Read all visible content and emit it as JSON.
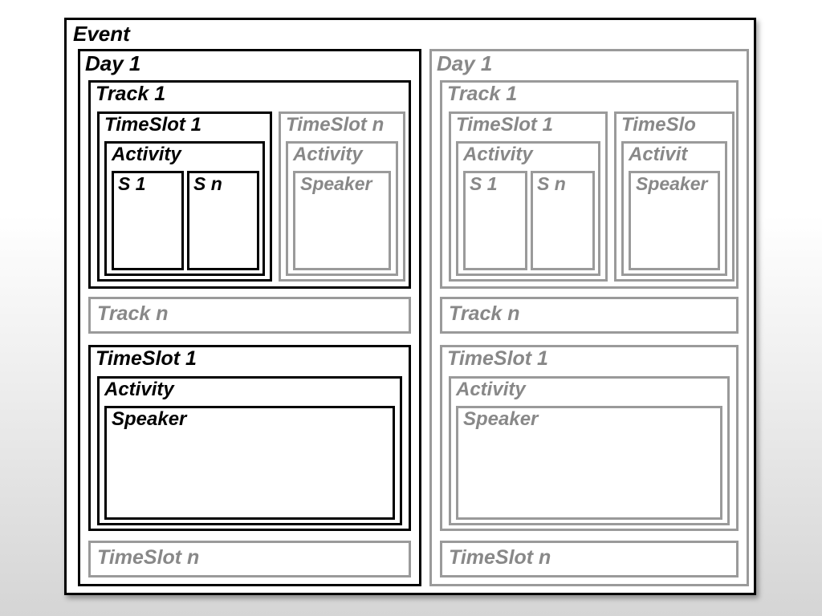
{
  "event": {
    "title": "Event"
  },
  "left": {
    "day": "Day 1",
    "track1": {
      "title": "Track 1",
      "ts1": {
        "title": "TimeSlot 1",
        "activity": "Activity",
        "s1": "S 1",
        "sn": "S n"
      },
      "tsn": {
        "title": "TimeSlot n",
        "activity": "Activity",
        "speaker": "Speaker"
      }
    },
    "trackn": "Track n",
    "timeslot1": {
      "title": "TimeSlot 1",
      "activity": "Activity",
      "speaker": "Speaker"
    },
    "timeslotn": "TimeSlot n"
  },
  "right": {
    "day": "Day 1",
    "track1": {
      "title": "Track 1",
      "ts1": {
        "title": "TimeSlot 1",
        "activity": "Activity",
        "s1": "S 1",
        "sn": "S n"
      },
      "tsn": {
        "title": "TimeSlo",
        "activity": "Activit",
        "speaker": "Speaker"
      }
    },
    "trackn": "Track n",
    "timeslot1": {
      "title": "TimeSlot 1",
      "activity": "Activity",
      "speaker": "Speaker"
    },
    "timeslotn": "TimeSlot n"
  }
}
